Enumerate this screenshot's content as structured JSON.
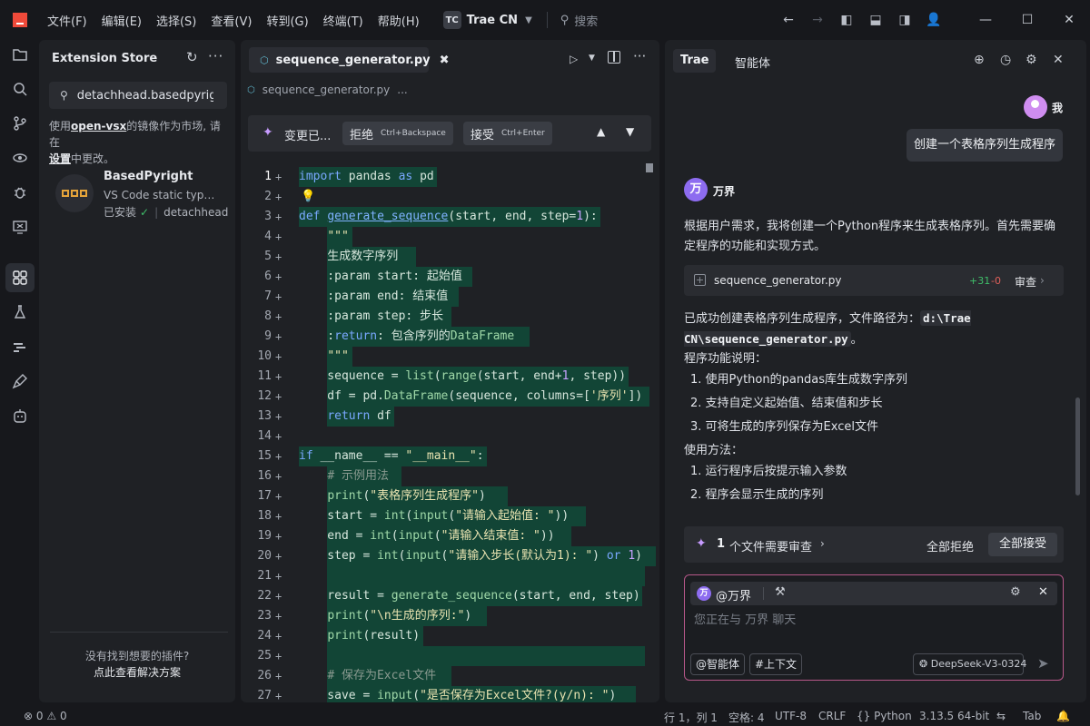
{
  "titlebar": {
    "menu": [
      "文件(F)",
      "编辑(E)",
      "选择(S)",
      "查看(V)",
      "转到(G)",
      "终端(T)",
      "帮助(H)"
    ],
    "workspace_initials": "TC",
    "workspace_name": "Trae CN",
    "search_placeholder": "搜索",
    "icons": [
      "arrow-left-icon",
      "arrow-right-icon",
      "layout-left-icon",
      "layout-bottom-icon",
      "layout-right-icon",
      "account-icon"
    ]
  },
  "activity_bar": {
    "items": [
      "explorer-icon",
      "search-icon",
      "source-control-icon",
      "remote-icon",
      "debug-icon",
      "run-panel-icon",
      "extensions-icon",
      "testing-icon",
      "ai-icon",
      "brush-icon",
      "robot-icon"
    ],
    "active": "extensions-icon"
  },
  "extensions": {
    "title": "Extension Store",
    "search_value": "detachhead.basedpyright",
    "note_prefix": "使用",
    "note_link": "open-vsx",
    "note_middle": "的镜像作为市场, 请在",
    "note_link2": "设置",
    "note_suffix": "中更改。",
    "item": {
      "name": "BasedPyright",
      "description": "VS Code static type checking for Python (but based)",
      "status": "已安装",
      "publisher": "detachhead"
    },
    "footer_question": "没有找到想要的插件?",
    "footer_link": "点此查看解决方案",
    "accent": "#e6a43a"
  },
  "editor": {
    "tab_label": "sequence_generator.py",
    "breadcrumb_file": "sequence_generator.py",
    "breadcrumb_more": "...",
    "diff": {
      "label": "变更已...",
      "reject_label": "拒绝",
      "reject_shortcut": "Ctrl+Backspace",
      "accept_label": "接受",
      "accept_shortcut": "Ctrl+Enter"
    },
    "lines": [
      {
        "n": "1",
        "code": "import pandas as pd"
      },
      {
        "n": "2",
        "code": ""
      },
      {
        "n": "3",
        "code": "def generate_sequence(start, end, step=1):"
      },
      {
        "n": "4",
        "code": "    \"\"\""
      },
      {
        "n": "5",
        "code": "    生成数字序列"
      },
      {
        "n": "6",
        "code": "    :param start: 起始值"
      },
      {
        "n": "7",
        "code": "    :param end: 结束值"
      },
      {
        "n": "8",
        "code": "    :param step: 步长"
      },
      {
        "n": "9",
        "code": "    :return: 包含序列的DataFrame"
      },
      {
        "n": "10",
        "code": "    \"\"\""
      },
      {
        "n": "11",
        "code": "    sequence = list(range(start, end+1, step))"
      },
      {
        "n": "12",
        "code": "    df = pd.DataFrame(sequence, columns=['序列'])"
      },
      {
        "n": "13",
        "code": "    return df"
      },
      {
        "n": "14",
        "code": ""
      },
      {
        "n": "15",
        "code": "if __name__ == \"__main__\":"
      },
      {
        "n": "16",
        "code": "    # 示例用法"
      },
      {
        "n": "17",
        "code": "    print(\"表格序列生成程序\")"
      },
      {
        "n": "18",
        "code": "    start = int(input(\"请输入起始值: \"))"
      },
      {
        "n": "19",
        "code": "    end = int(input(\"请输入结束值: \"))"
      },
      {
        "n": "20",
        "code": "    step = int(input(\"请输入步长(默认为1): \") or 1)"
      },
      {
        "n": "21",
        "code": ""
      },
      {
        "n": "22",
        "code": "    result = generate_sequence(start, end, step)"
      },
      {
        "n": "23",
        "code": "    print(\"\\n生成的序列:\")"
      },
      {
        "n": "24",
        "code": "    print(result)"
      },
      {
        "n": "25",
        "code": ""
      },
      {
        "n": "26",
        "code": "    # 保存为Excel文件"
      },
      {
        "n": "27",
        "code": "    save = input(\"是否保存为Excel文件?(y/n): \")"
      }
    ],
    "diff_bg": "#124536"
  },
  "chat": {
    "tab_active": "Trae",
    "tab_other": "智能体",
    "user_name": "我",
    "user_message": "创建一个表格序列生成程序",
    "ai_avatar": "万",
    "ai_name": "万界",
    "ai_intro": "根据用户需求，我将创建一个Python程序来生成表格序列。首先需要确定程序的功能和实现方式。",
    "file_card": {
      "name": "sequence_generator.py",
      "added": "+31",
      "removed": "-0",
      "action": "审查"
    },
    "result_prefix": "已成功创建表格序列生成程序，文件路径为：",
    "result_path": "d:\\Trae CN\\sequence_generator.py",
    "result_suffix": "。",
    "features_title": "程序功能说明：",
    "features": [
      "1. 使用Python的pandas库生成数字序列",
      "2. 支持自定义起始值、结束值和步长",
      "3. 可将生成的序列保存为Excel文件"
    ],
    "usage_title": "使用方法：",
    "usage": [
      "1. 运行程序后按提示输入参数",
      "2. 程序会显示生成的序列"
    ],
    "review": {
      "count": "1",
      "label": "个文件需要审查",
      "reject_all": "全部拒绝",
      "accept_all": "全部接受"
    },
    "composer": {
      "agent": "@万界",
      "placeholder": "您正在与 万界 聊天",
      "chip_agent": "@智能体",
      "chip_context": "#上下文",
      "model": "DeepSeek-V3-0324"
    },
    "accent_border": "#b7588a"
  },
  "statusbar": {
    "errors": "0",
    "warnings": "0",
    "position": "行 1，列 1",
    "spaces": "空格: 4",
    "encoding": "UTF-8",
    "eol": "CRLF",
    "language": "Python",
    "interpreter": "3.13.5 64-bit",
    "tab": "Tab"
  }
}
